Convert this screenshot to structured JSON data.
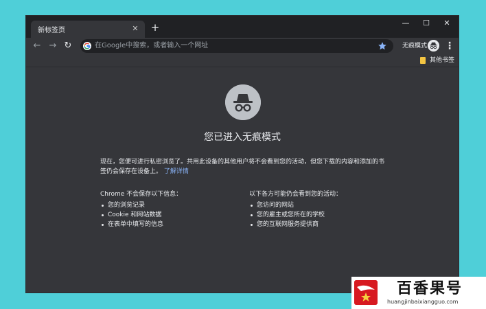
{
  "tab": {
    "title": "新标签页",
    "close": "✕"
  },
  "titlebar": {
    "new_tab": "+",
    "minimize": "—",
    "maximize": "☐",
    "close": "✕"
  },
  "toolbar": {
    "back": "←",
    "forward": "→",
    "reload": "↻",
    "omnibox_placeholder": "在Google中搜索，或者输入一个网址",
    "incognito_label": "无痕模式",
    "menu": "⋮"
  },
  "bookmarks": {
    "other_label": "其他书签"
  },
  "page": {
    "heading": "您已进入无痕模式",
    "intro": "现在，您便可进行私密浏览了。共用此设备的其他用户将不会看到您的活动，但您下载的内容和添加的书签仍会保存在设备上。",
    "learn_more": "了解详情",
    "left_heading": "Chrome 不会保存以下信息：",
    "left_items": [
      "您的浏览记录",
      "Cookie 和网站数据",
      "在表单中填写的信息"
    ],
    "right_heading": "以下各方可能仍会看到您的活动：",
    "right_items": [
      "您访问的网站",
      "您的雇主或您所在的学校",
      "您的互联网服务提供商"
    ]
  },
  "watermark": {
    "name": "百香果号",
    "url": "huangjinbaixiangguo.com"
  },
  "colors": {
    "desktop": "#4fcfd8",
    "titlebar": "#202124",
    "window": "#35363a",
    "link": "#8ab4f8",
    "star": "#8ab4f8",
    "bookmark_folder": "#f4c542",
    "watermark_red": "#d71920"
  },
  "icons": [
    "google-icon",
    "star-icon",
    "incognito-icon",
    "folder-icon",
    "spy-icon"
  ]
}
